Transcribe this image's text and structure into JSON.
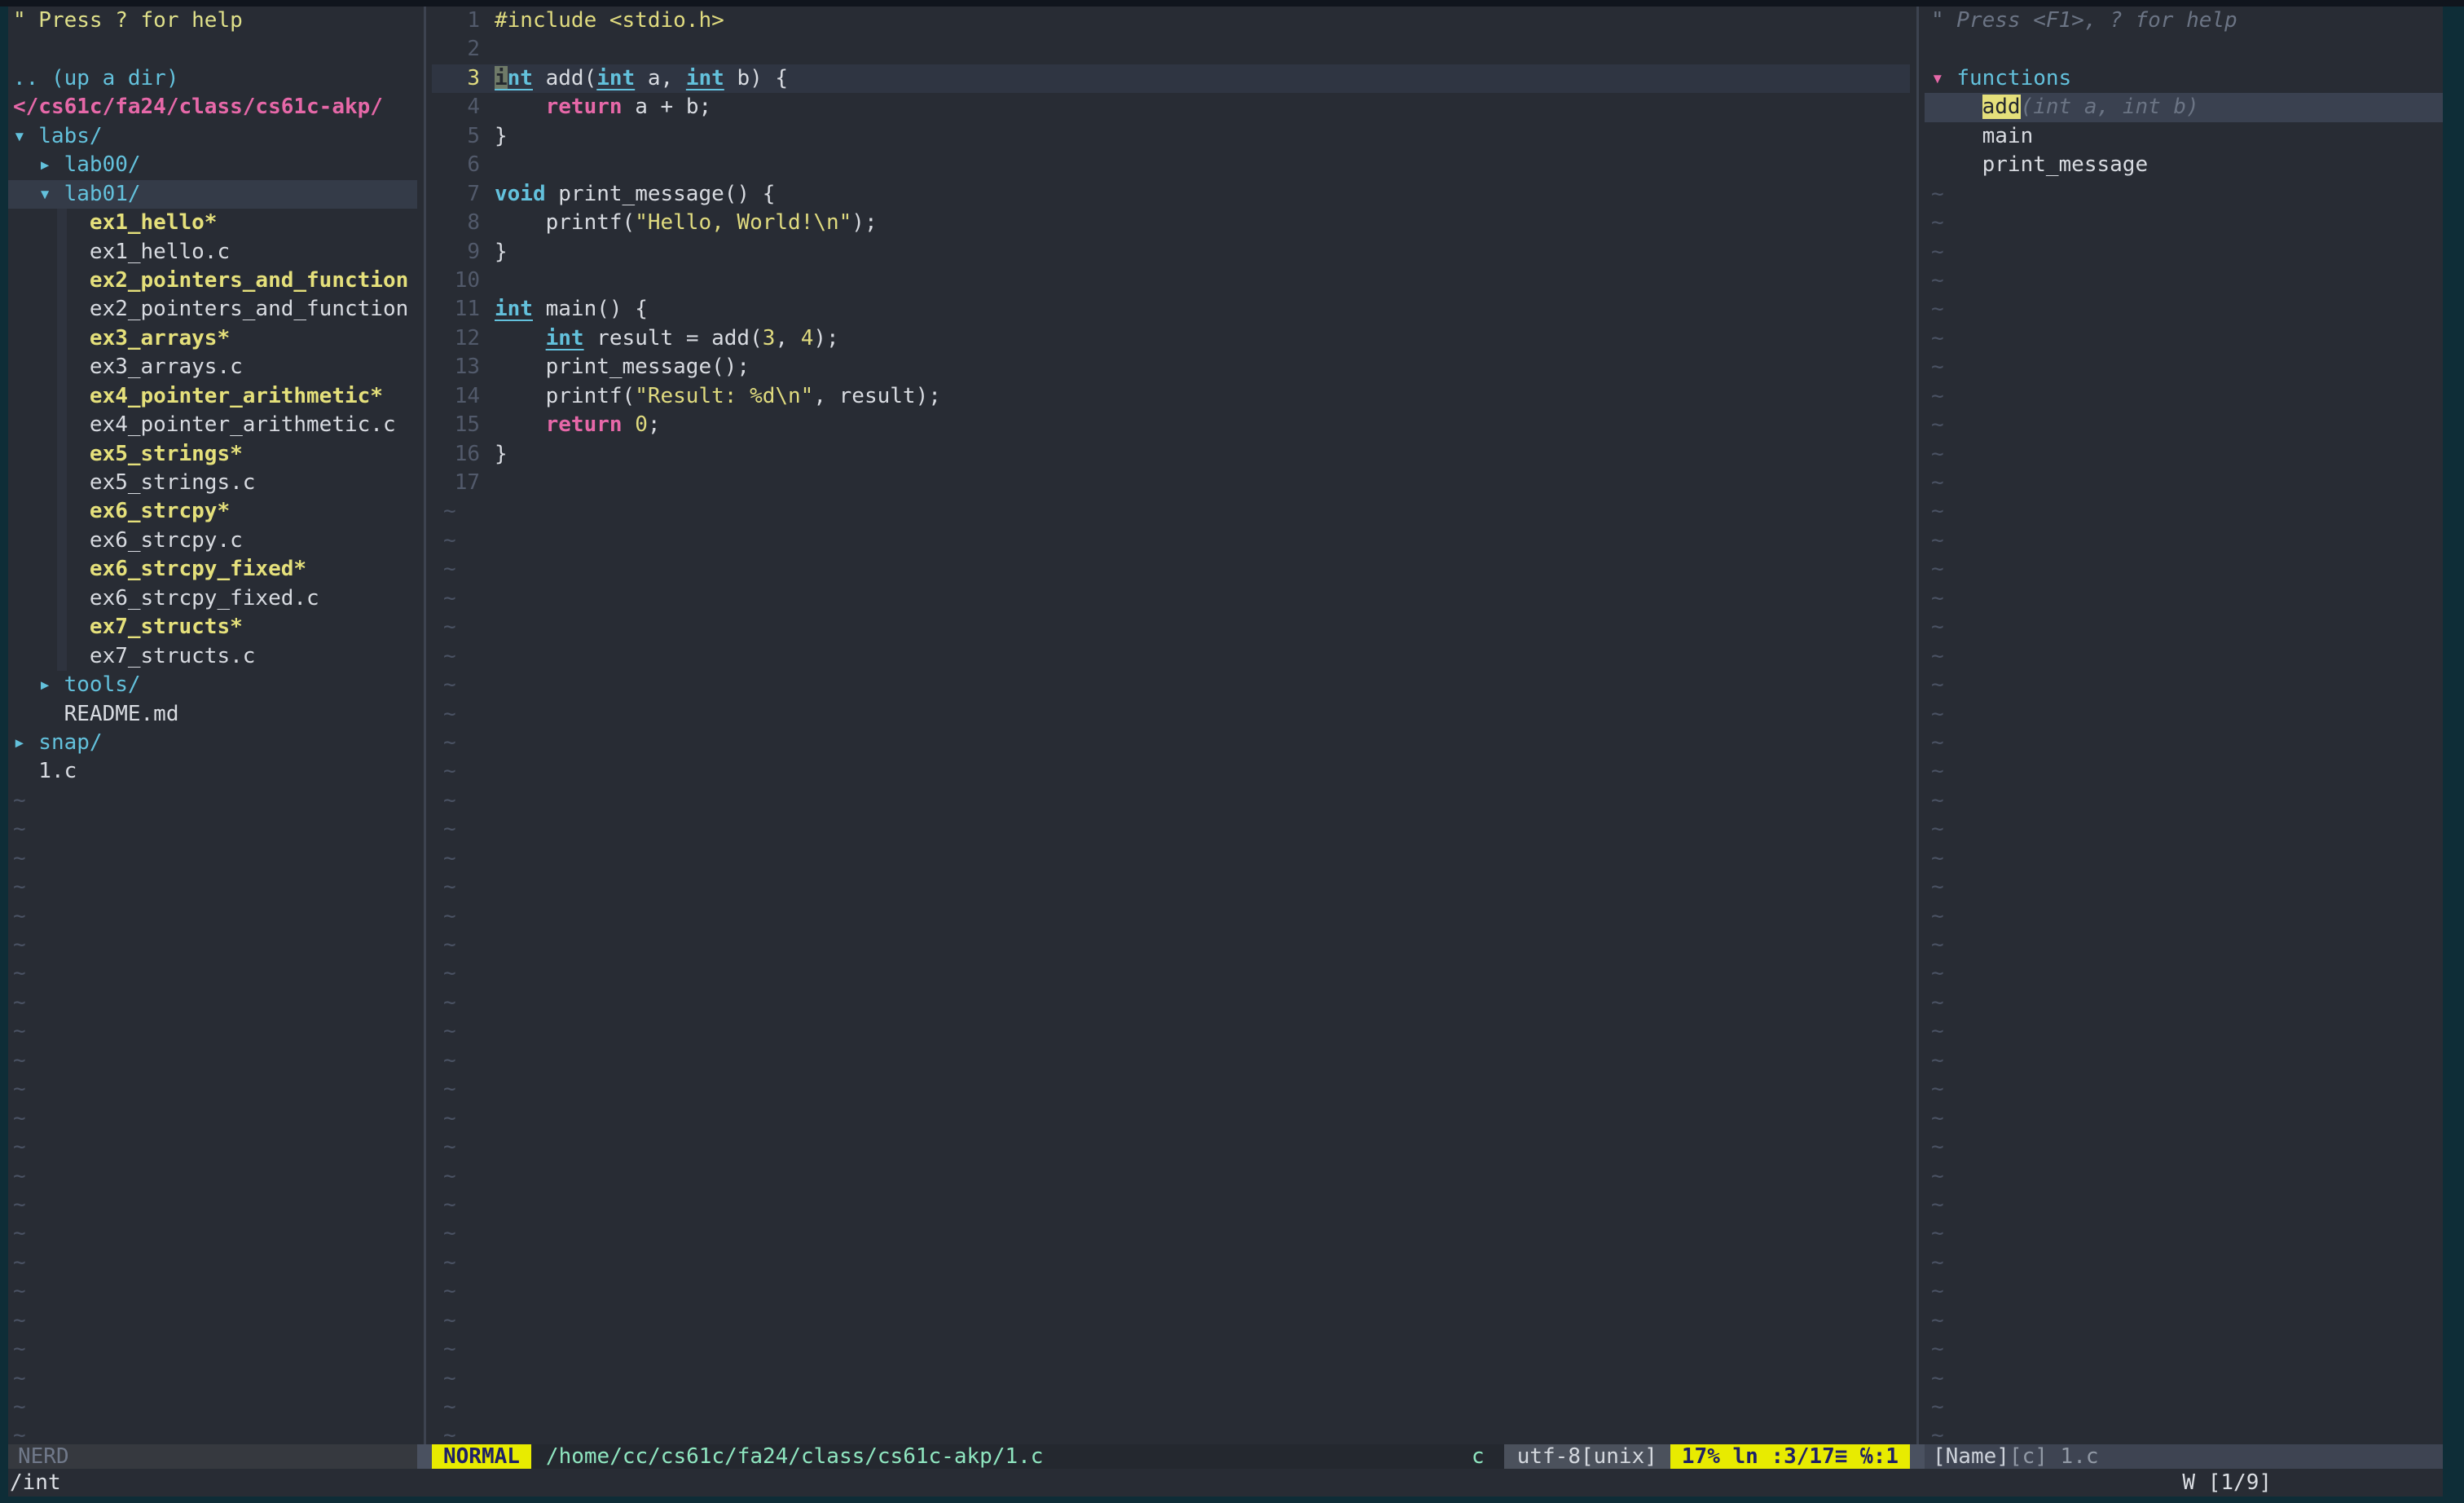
{
  "colors": {
    "background": "#282c34",
    "outer_border": "#0e2d37",
    "accent_cyan": "#63c1dc",
    "accent_pink": "#e668a8",
    "accent_yellow": "#e5e07b",
    "mode_bar_yellow": "#e8eb00",
    "status_path_teal": "#8fe6c0",
    "selection_bg": "#343b48"
  },
  "nerdtree": {
    "rows": [
      {
        "style": "help",
        "text": "\" Press ? for help"
      },
      {
        "style": "blank",
        "text": ""
      },
      {
        "style": "updir",
        "text": ".. (up a dir)"
      },
      {
        "style": "rootpath",
        "text": "</cs61c/fa24/class/cs61c-akp/"
      },
      {
        "style": "dir",
        "text": "▾ labs/"
      },
      {
        "style": "dir",
        "text": "  ▸ lab00/"
      },
      {
        "style": "dir",
        "text": "  ▾ lab01/",
        "selected": true
      },
      {
        "style": "exec",
        "text": "      ex1_hello*"
      },
      {
        "style": "file",
        "text": "      ex1_hello.c"
      },
      {
        "style": "exec",
        "text": "      ex2_pointers_and_function"
      },
      {
        "style": "file",
        "text": "      ex2_pointers_and_function"
      },
      {
        "style": "exec",
        "text": "      ex3_arrays*"
      },
      {
        "style": "file",
        "text": "      ex3_arrays.c"
      },
      {
        "style": "exec",
        "text": "      ex4_pointer_arithmetic*"
      },
      {
        "style": "file",
        "text": "      ex4_pointer_arithmetic.c"
      },
      {
        "style": "exec",
        "text": "      ex5_strings*"
      },
      {
        "style": "file",
        "text": "      ex5_strings.c"
      },
      {
        "style": "exec",
        "text": "      ex6_strcpy*"
      },
      {
        "style": "file",
        "text": "      ex6_strcpy.c"
      },
      {
        "style": "exec",
        "text": "      ex6_strcpy_fixed*"
      },
      {
        "style": "file",
        "text": "      ex6_strcpy_fixed.c"
      },
      {
        "style": "exec",
        "text": "      ex7_structs*"
      },
      {
        "style": "file",
        "text": "      ex7_structs.c"
      },
      {
        "style": "dir",
        "text": "  ▸ tools/"
      },
      {
        "style": "file",
        "text": "    README.md"
      },
      {
        "style": "dir",
        "text": "▸ snap/"
      },
      {
        "style": "file",
        "text": "  1.c"
      }
    ],
    "tilde_rows": 23,
    "statusline_label": "NERD"
  },
  "editor": {
    "lines": [
      {
        "num": "1",
        "tokens": [
          [
            "pp",
            "#include <stdio.h>"
          ]
        ]
      },
      {
        "num": "2",
        "tokens": []
      },
      {
        "num": "3",
        "current": true,
        "tokens": [
          [
            "cursor",
            "i"
          ],
          [
            "tu",
            "nt"
          ],
          [
            "p",
            " add("
          ],
          [
            "tu",
            "int"
          ],
          [
            "p",
            " a, "
          ],
          [
            "tu",
            "int"
          ],
          [
            "p",
            " b) {"
          ]
        ]
      },
      {
        "num": "4",
        "tokens": [
          [
            "p",
            "    "
          ],
          [
            "k",
            "return"
          ],
          [
            "p",
            " a + b;"
          ]
        ]
      },
      {
        "num": "5",
        "tokens": [
          [
            "p",
            "}"
          ]
        ]
      },
      {
        "num": "6",
        "tokens": []
      },
      {
        "num": "7",
        "tokens": [
          [
            "t",
            "void"
          ],
          [
            "p",
            " print_message() {"
          ]
        ]
      },
      {
        "num": "8",
        "tokens": [
          [
            "p",
            "    printf("
          ],
          [
            "s",
            "\"Hello, World!\\n\""
          ],
          [
            "p",
            ");"
          ]
        ]
      },
      {
        "num": "9",
        "tokens": [
          [
            "p",
            "}"
          ]
        ]
      },
      {
        "num": "10",
        "tokens": []
      },
      {
        "num": "11",
        "tokens": [
          [
            "tu",
            "int"
          ],
          [
            "p",
            " main() {"
          ]
        ]
      },
      {
        "num": "12",
        "tokens": [
          [
            "p",
            "    "
          ],
          [
            "tu",
            "int"
          ],
          [
            "p",
            " result = add("
          ],
          [
            "n",
            "3"
          ],
          [
            "p",
            ", "
          ],
          [
            "n",
            "4"
          ],
          [
            "p",
            ");"
          ]
        ]
      },
      {
        "num": "13",
        "tokens": [
          [
            "p",
            "    print_message();"
          ]
        ]
      },
      {
        "num": "14",
        "tokens": [
          [
            "p",
            "    printf("
          ],
          [
            "s",
            "\"Result: %d\\n\""
          ],
          [
            "p",
            ", result);"
          ]
        ]
      },
      {
        "num": "15",
        "tokens": [
          [
            "p",
            "    "
          ],
          [
            "k",
            "return"
          ],
          [
            "p",
            " "
          ],
          [
            "n",
            "0"
          ],
          [
            "p",
            ";"
          ]
        ]
      },
      {
        "num": "16",
        "tokens": [
          [
            "p",
            "}"
          ]
        ]
      },
      {
        "num": "17",
        "tokens": []
      }
    ],
    "tilde_rows": 33
  },
  "statusbar": {
    "mode": "NORMAL",
    "file_path": "/home/cc/cs61c/fa24/class/cs61c-akp/1.c",
    "filetype": "c",
    "encoding": "utf-8[unix]",
    "position": "17%  ln :3/17≡ ℅:1"
  },
  "tagbar": {
    "rows": [
      {
        "tokens": [
          [
            "thelp",
            "\" Press <F1>, ? for help"
          ]
        ]
      },
      {
        "tokens": []
      },
      {
        "tokens": [
          [
            "arrow",
            "▾ "
          ],
          [
            "dir",
            "functions"
          ]
        ]
      },
      {
        "selected": true,
        "tokens": [
          [
            "p",
            "    "
          ],
          [
            "tag-active",
            "add"
          ],
          [
            "sig",
            "(int a, int b)"
          ]
        ]
      },
      {
        "tokens": [
          [
            "p",
            "    main"
          ]
        ]
      },
      {
        "tokens": [
          [
            "p",
            "    print_message"
          ]
        ]
      }
    ],
    "tilde_rows": 44,
    "statusline_left": "[Name]",
    "statusline_right": "[c] 1.c"
  },
  "cmdline": {
    "search": "/int",
    "match_count": "W [1/9]"
  }
}
